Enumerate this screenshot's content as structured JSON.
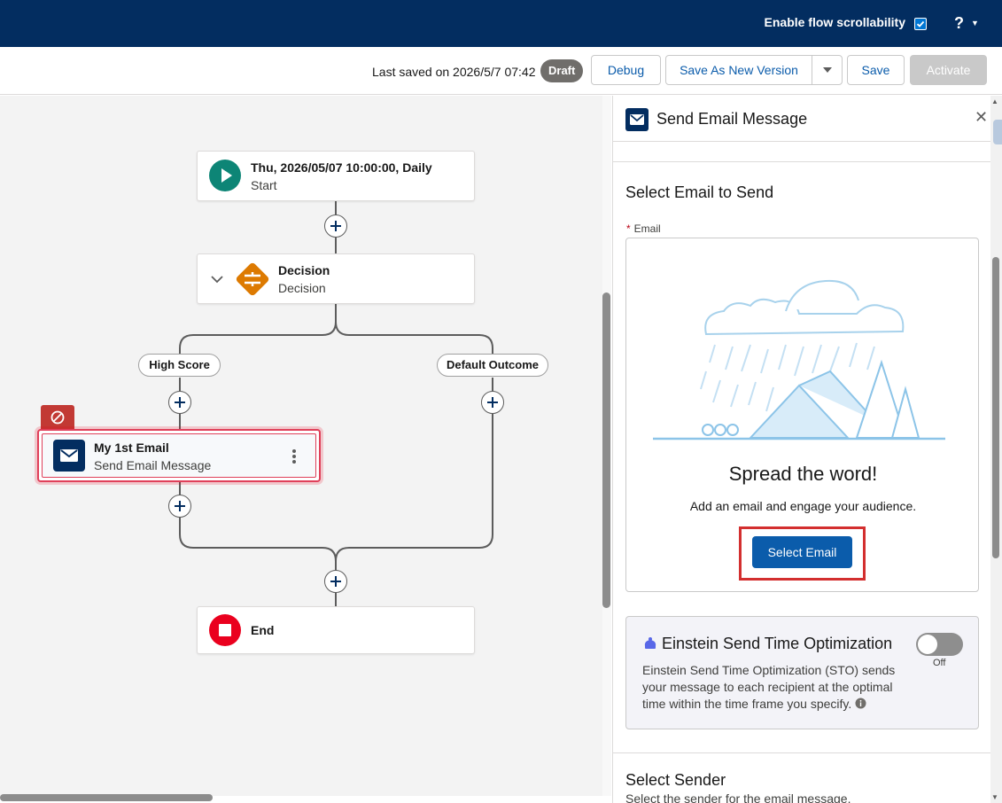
{
  "topbar": {
    "scroll_label": "Enable flow scrollability",
    "scroll_checked": true,
    "help_label": "?"
  },
  "toolbar": {
    "last_saved": "Last saved on 2026/5/7 07:42",
    "status_badge": "Draft",
    "debug_label": "Debug",
    "save_as_label": "Save As New Version",
    "save_label": "Save",
    "activate_label": "Activate"
  },
  "flow": {
    "start": {
      "title": "Thu, 2026/05/07 10:00:00, Daily",
      "subtitle": "Start"
    },
    "decision": {
      "title": "Decision",
      "subtitle": "Decision"
    },
    "outcomes": [
      "High Score",
      "Default Outcome"
    ],
    "email_node": {
      "title": "My 1st Email",
      "subtitle": "Send Email Message"
    },
    "end": {
      "title": "End"
    }
  },
  "panel": {
    "title": "Send Email Message",
    "section_title": "Select Email to Send",
    "email_label": "Email",
    "empty_title": "Spread the word!",
    "empty_subtitle": "Add an email and engage your audience.",
    "select_button": "Select Email",
    "einstein": {
      "title": "Einstein Send Time Optimization",
      "description": "Einstein Send Time Optimization (STO) sends your message to each recipient at the optimal time within the time frame you specify.",
      "toggle_label": "Off",
      "toggle_on": false
    },
    "sender_title": "Select Sender",
    "sender_subtitle": "Select the sender for the email message."
  },
  "colors": {
    "header_bg": "#032d60",
    "brand_blue": "#0b5cab",
    "start_green": "#0d8576",
    "decision_orange": "#dd7a01",
    "end_red": "#ea001e",
    "error_red": "#c23934",
    "highlight_red": "#d32f2f"
  }
}
